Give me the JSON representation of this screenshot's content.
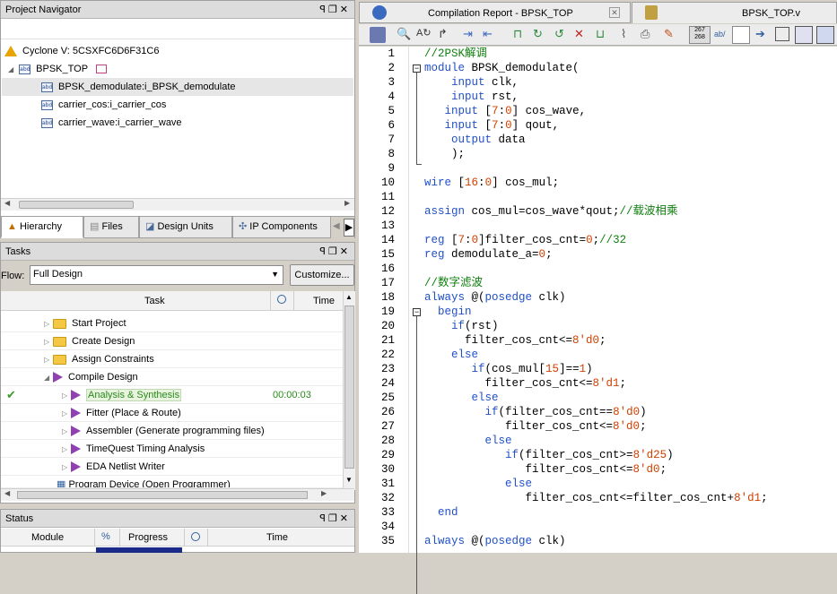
{
  "navigator": {
    "title": "Project Navigator",
    "device": "Cyclone V: 5CSXFC6D6F31C6",
    "top": "BPSK_TOP",
    "children": [
      "BPSK_demodulate:i_BPSK_demodulate",
      "carrier_cos:i_carrier_cos",
      "carrier_wave:i_carrier_wave"
    ],
    "tabs": [
      "Hierarchy",
      "Files",
      "Design Units",
      "IP Components"
    ]
  },
  "tasks": {
    "title": "Tasks",
    "flow_label": "Flow:",
    "flow_value": "Full Design",
    "customize": "Customize...",
    "col_task": "Task",
    "col_time": "Time",
    "rows": [
      {
        "label": "Start Project",
        "time": ""
      },
      {
        "label": "Create Design",
        "time": ""
      },
      {
        "label": "Assign Constraints",
        "time": ""
      },
      {
        "label": "Compile Design",
        "time": ""
      },
      {
        "label": "Analysis & Synthesis",
        "time": "00:00:03"
      },
      {
        "label": "Fitter (Place & Route)",
        "time": ""
      },
      {
        "label": "Assembler (Generate programming files)",
        "time": ""
      },
      {
        "label": "TimeQuest Timing Analysis",
        "time": ""
      },
      {
        "label": "EDA Netlist Writer",
        "time": ""
      },
      {
        "label": "Program Device (Open Programmer)",
        "time": ""
      }
    ]
  },
  "status": {
    "title": "Status",
    "col_module": "Module",
    "col_pct": "%",
    "col_progress": "Progress",
    "col_time": "Time"
  },
  "editor": {
    "tab1": "Compilation Report - BPSK_TOP",
    "tab2": "BPSK_TOP.v",
    "tb_text1": "267\n268",
    "tb_text2": "ab/",
    "line_numbers": [
      "1",
      "2",
      "3",
      "4",
      "5",
      "6",
      "7",
      "8",
      "9",
      "10",
      "11",
      "12",
      "13",
      "14",
      "15",
      "16",
      "17",
      "18",
      "19",
      "20",
      "21",
      "22",
      "23",
      "24",
      "25",
      "26",
      "27",
      "28",
      "29",
      "30",
      "31",
      "32",
      "33",
      "34",
      "35"
    ]
  },
  "colors": {
    "keyword": "#2050c8",
    "comment": "#108010",
    "number": "#d04000",
    "highlight": "#e6e6e6"
  }
}
